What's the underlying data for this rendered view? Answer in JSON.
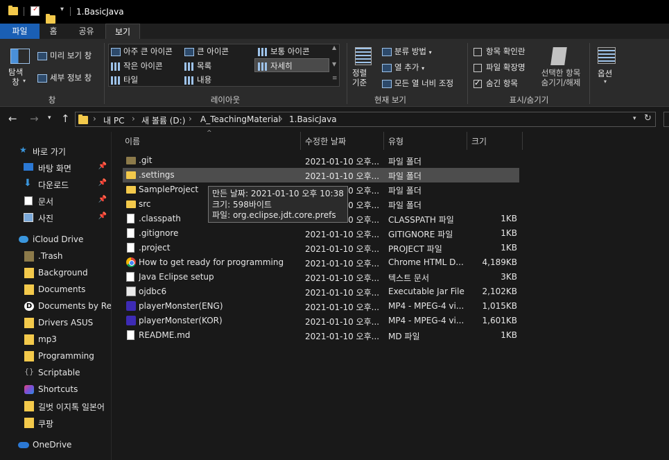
{
  "window": {
    "title": "1.BasicJava"
  },
  "ribbon": {
    "tabs": [
      "파일",
      "홈",
      "공유",
      "보기"
    ],
    "pane_group": {
      "nav_pane_label": "탐색\n창",
      "preview_label": "미리 보기 창",
      "details_label": "세부 정보 창",
      "group_label": "창"
    },
    "layout_group": {
      "items": [
        "아주 큰 아이콘",
        "큰 아이콘",
        "보통 아이콘",
        "작은 아이콘",
        "목록",
        "자세히",
        "타일",
        "내용"
      ],
      "selected": "자세히",
      "group_label": "레이아웃"
    },
    "current_view_group": {
      "sort_label": "정렬\n기준",
      "group_by": "분류 방법",
      "add_column": "열 추가",
      "size_all_columns": "모든 열 너비 조정",
      "group_label": "현재 보기"
    },
    "show_hide_group": {
      "item_checkboxes": {
        "label": "항목 확인란",
        "checked": false
      },
      "file_extensions": {
        "label": "파일 확장명",
        "checked": false
      },
      "hidden_items": {
        "label": "숨긴 항목",
        "checked": true
      },
      "hide_selected": "선택한 항목\n숨기기/해제",
      "group_label": "표시/숨기기"
    },
    "options_label": "옵션"
  },
  "address": {
    "crumbs": [
      "내 PC",
      "새 볼륨 (D:)",
      "A_TeachingMaterial",
      "1.BasicJava"
    ]
  },
  "nav": {
    "quick_access": "바로 가기",
    "pinned": [
      "바탕 화면",
      "다운로드",
      "문서",
      "사진"
    ],
    "icloud": "iCloud Drive",
    "icloud_items": [
      ".Trash",
      "Background",
      "Documents",
      "Documents by Rea",
      "Drivers ASUS",
      "mp3",
      "Programming",
      "Scriptable",
      "Shortcuts",
      "길벗 이지톡 일본어",
      "쿠팡"
    ],
    "onedrive": "OneDrive"
  },
  "columns": [
    "이름",
    "수정한 날짜",
    "유형",
    "크기"
  ],
  "files": [
    {
      "name": ".git",
      "date": "2021-01-10 오후...",
      "type": "파일 폴더",
      "size": "",
      "icon": "folder-dark-icon"
    },
    {
      "name": ".settings",
      "date": "2021-01-10 오후...",
      "type": "파일 폴더",
      "size": "",
      "icon": "folder-icon"
    },
    {
      "name": "SampleProject",
      "date": "2021-01-10 오후...",
      "type": "파일 폴더",
      "size": "",
      "icon": "folder-icon"
    },
    {
      "name": "src",
      "date": "2021-01-10 오후...",
      "type": "파일 폴더",
      "size": "",
      "icon": "folder-icon"
    },
    {
      "name": ".classpath",
      "date": "2021-01-10 오후...",
      "type": "CLASSPATH 파일",
      "size": "1KB",
      "icon": "file-icon"
    },
    {
      "name": ".gitignore",
      "date": "2021-01-10 오후...",
      "type": "GITIGNORE 파일",
      "size": "1KB",
      "icon": "file-icon"
    },
    {
      "name": ".project",
      "date": "2021-01-10 오후...",
      "type": "PROJECT 파일",
      "size": "1KB",
      "icon": "file-icon"
    },
    {
      "name": "How to get ready for programming",
      "date": "2021-01-10 오후...",
      "type": "Chrome HTML D...",
      "size": "4,189KB",
      "icon": "chrome-icon"
    },
    {
      "name": "Java Eclipse setup",
      "date": "2021-01-10 오후...",
      "type": "텍스트 문서",
      "size": "3KB",
      "icon": "text-file-icon"
    },
    {
      "name": "ojdbc6",
      "date": "2021-01-10 오후...",
      "type": "Executable Jar File",
      "size": "2,102KB",
      "icon": "jar-icon"
    },
    {
      "name": "playerMonster(ENG)",
      "date": "2021-01-10 오후...",
      "type": "MP4 - MPEG-4 vi...",
      "size": "1,015KB",
      "icon": "mp4-icon"
    },
    {
      "name": "playerMonster(KOR)",
      "date": "2021-01-10 오후...",
      "type": "MP4 - MPEG-4 vi...",
      "size": "1,601KB",
      "icon": "mp4-icon"
    },
    {
      "name": "README.md",
      "date": "2021-01-10 오후...",
      "type": "MD 파일",
      "size": "1KB",
      "icon": "file-icon"
    }
  ],
  "tooltip": {
    "line1": "만든 날짜: 2021-01-10 오후 10:38",
    "line2": "크기: 598바이트",
    "line3": "파일: org.eclipse.jdt.core.prefs"
  }
}
